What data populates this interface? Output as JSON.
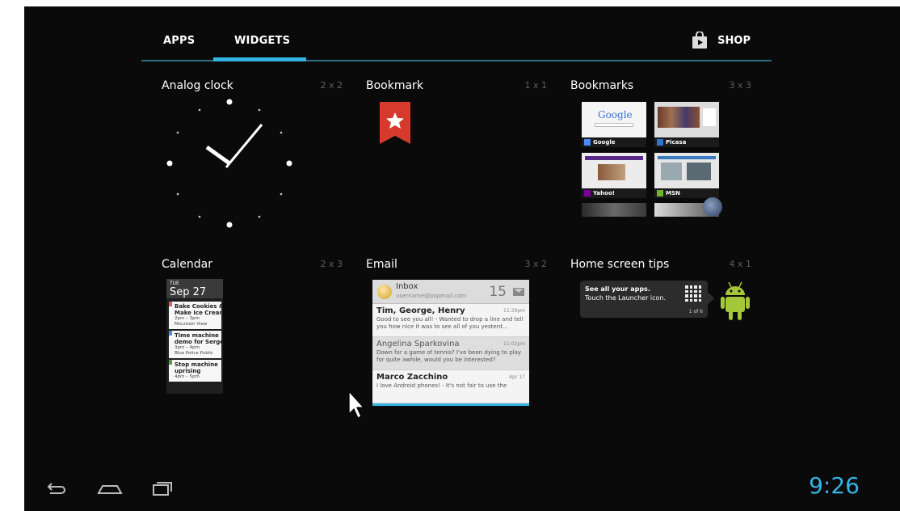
{
  "tabs": {
    "apps": "APPS",
    "widgets": "WIDGETS",
    "shop": "SHOP"
  },
  "widgets": [
    {
      "name": "Analog clock",
      "size": "2 x 2"
    },
    {
      "name": "Bookmark",
      "size": "1 x 1"
    },
    {
      "name": "Bookmarks",
      "size": "3 x 3"
    },
    {
      "name": "Calendar",
      "size": "2 x 3"
    },
    {
      "name": "Email",
      "size": "3 x 2"
    },
    {
      "name": "Home screen tips",
      "size": "4 x 1"
    }
  ],
  "calendar": {
    "day": "TUE",
    "date": "Sep 27",
    "events": [
      {
        "title": "Bake Cookies &\nMake Ice Cream",
        "time": "2pm – 3pm",
        "location": "Mountain View"
      },
      {
        "title": "Time machine\ndemo for Serge",
        "time": "3pm – 4pm",
        "location": "Blue Police Public"
      },
      {
        "title": "Stop machine\nuprising",
        "time": "4pm – 5pm",
        "location": ""
      }
    ]
  },
  "email": {
    "inbox": "Inbox",
    "account": "username@popmail.com",
    "unread": "15",
    "messages": [
      {
        "from": "Tim, George, Henry",
        "time": "11:29pm",
        "snippet": "Good to see you all! - Wanted to drop a line and tell you how nice it was to see all of you yesterd..."
      },
      {
        "from": "Angelina Sparkovina",
        "time": "11:02pm",
        "snippet": "Down for a game of tennis? I've been dying to play for quite awhile, would you be interested?"
      },
      {
        "from": "Marco Zacchino",
        "time": "Apr 17",
        "snippet": "I love Android phones! - It's not fair to use the"
      }
    ]
  },
  "bookmarks": {
    "items": [
      "Google",
      "Picasa",
      "Yahoo!",
      "MSN"
    ],
    "google_logo": "Google"
  },
  "tips": {
    "title": "See all your apps.",
    "body": "Touch the Launcher icon.",
    "page": "1 of 6"
  },
  "status": {
    "time": "9:26"
  },
  "colors": {
    "accent": "#33b5e5",
    "bookmark_red": "#d63a2c",
    "android_green": "#a4c639"
  }
}
